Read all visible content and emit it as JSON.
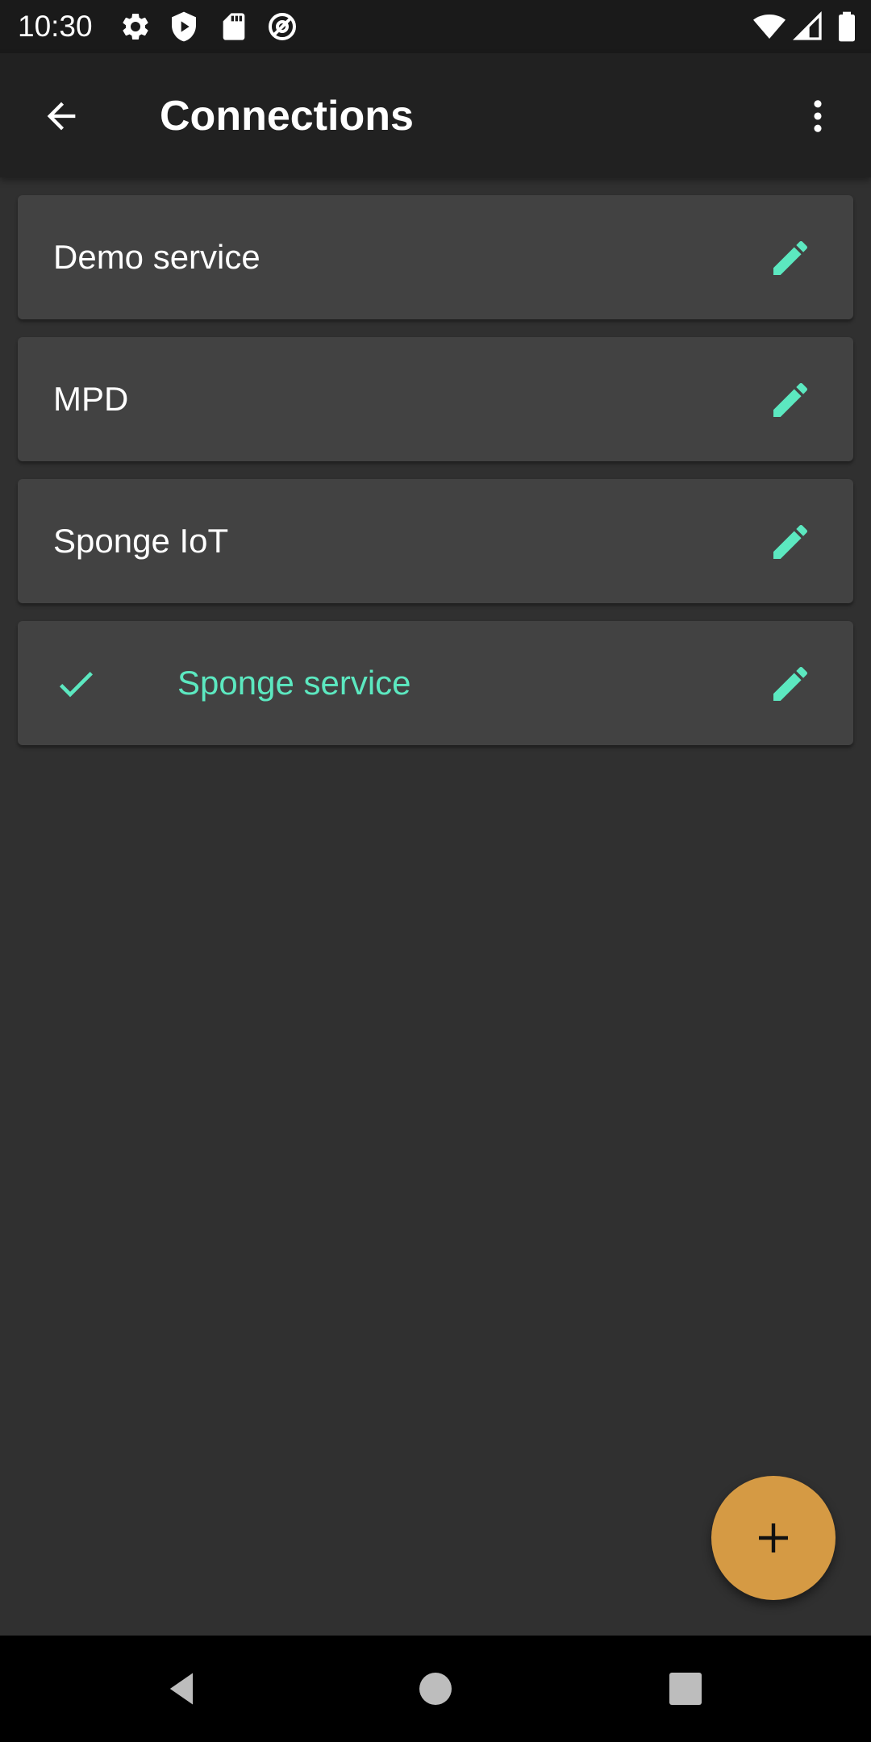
{
  "status_bar": {
    "time": "10:30",
    "icons_left": [
      "settings-icon",
      "shield-play-icon",
      "sd-card-icon",
      "at-sign-icon"
    ],
    "icons_right": [
      "wifi-icon",
      "cell-signal-icon",
      "battery-icon"
    ]
  },
  "app_bar": {
    "title": "Connections",
    "back_icon": "arrow-back-icon",
    "overflow_icon": "more-vert-icon"
  },
  "connections": [
    {
      "label": "Demo service",
      "selected": false
    },
    {
      "label": "MPD",
      "selected": false
    },
    {
      "label": "Sponge IoT",
      "selected": false
    },
    {
      "label": "Sponge service",
      "selected": true
    }
  ],
  "fab": {
    "icon": "plus-icon"
  },
  "nav_bar": {
    "icons": [
      "back-triangle-icon",
      "home-circle-icon",
      "recents-square-icon"
    ]
  },
  "colors": {
    "background": "#303030",
    "app_bar": "#212121",
    "card": "#424242",
    "accent": "#5ce8c0",
    "fab": "#d59a44"
  }
}
